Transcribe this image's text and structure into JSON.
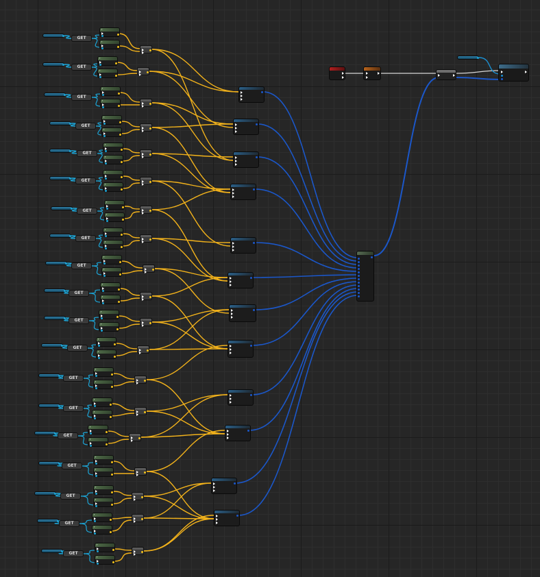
{
  "graph": {
    "get_label": "GET",
    "func_label": "f",
    "sub_label": "",
    "make_label": "",
    "mid_label": "",
    "aggregate_label": "",
    "event_red_label": "",
    "event_orange_label": "",
    "sequence_label": "",
    "final_label": "",
    "colors": {
      "background": "#262626",
      "wire_float": "#f2b21b",
      "wire_struct": "#1b57c9",
      "wire_exec": "#d8d8d8",
      "wire_object": "#1b8fd1",
      "variable_pin": "#1ca6d8",
      "float_pin": "#f2c21b"
    }
  }
}
